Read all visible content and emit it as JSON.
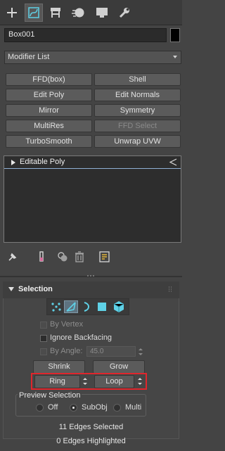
{
  "tabs": [
    {
      "name": "create",
      "icon": "plus-icon"
    },
    {
      "name": "modify",
      "icon": "modify-curve-icon",
      "active": true
    },
    {
      "name": "hierarchy",
      "icon": "hierarchy-icon"
    },
    {
      "name": "motion",
      "icon": "motion-icon"
    },
    {
      "name": "display",
      "icon": "monitor-icon"
    },
    {
      "name": "utilities",
      "icon": "wrench-icon"
    }
  ],
  "object_name": "Box001",
  "object_color": "#000000",
  "modifier_list": {
    "label": "Modifier List"
  },
  "modifier_buttons": [
    {
      "label": "FFD(box)",
      "enabled": true
    },
    {
      "label": "Shell",
      "enabled": true
    },
    {
      "label": "Edit Poly",
      "enabled": true
    },
    {
      "label": "Edit Normals",
      "enabled": true
    },
    {
      "label": "Mirror",
      "enabled": true
    },
    {
      "label": "Symmetry",
      "enabled": true
    },
    {
      "label": "MultiRes",
      "enabled": true
    },
    {
      "label": "FFD Select",
      "enabled": false
    },
    {
      "label": "TurboSmooth",
      "enabled": true
    },
    {
      "label": "Unwrap UVW",
      "enabled": true
    }
  ],
  "stack": {
    "items": [
      {
        "label": "Editable Poly"
      }
    ]
  },
  "stack_toolbar": [
    "pin-stack-icon",
    "show-end-result-icon",
    "make-unique-icon",
    "remove-modifier-icon",
    "configure-modifier-sets-icon"
  ],
  "selection": {
    "title": "Selection",
    "subobject_levels": [
      {
        "name": "vertex",
        "icon": "vertex-icon"
      },
      {
        "name": "edge",
        "icon": "edge-icon",
        "active": true
      },
      {
        "name": "border",
        "icon": "border-icon"
      },
      {
        "name": "polygon",
        "icon": "polygon-icon"
      },
      {
        "name": "element",
        "icon": "element-icon"
      }
    ],
    "by_vertex": {
      "label": "By Vertex",
      "checked": false,
      "enabled": false
    },
    "ignore_backfacing": {
      "label": "Ignore Backfacing",
      "checked": false,
      "enabled": true
    },
    "by_angle": {
      "label": "By Angle:",
      "checked": false,
      "enabled": false,
      "value": "45.0"
    },
    "shrink_label": "Shrink",
    "grow_label": "Grow",
    "ring_label": "Ring",
    "loop_label": "Loop",
    "preview": {
      "title": "Preview Selection",
      "options": [
        "Off",
        "SubObj",
        "Multi"
      ],
      "selected": "SubObj"
    },
    "edges_selected": "11 Edges Selected",
    "edges_highlighted": "0 Edges Highlighted"
  },
  "colors": {
    "highlight_box": "#e0262c",
    "active_subobj": "#5e7380",
    "stack_underline": "#8fb0d6"
  }
}
